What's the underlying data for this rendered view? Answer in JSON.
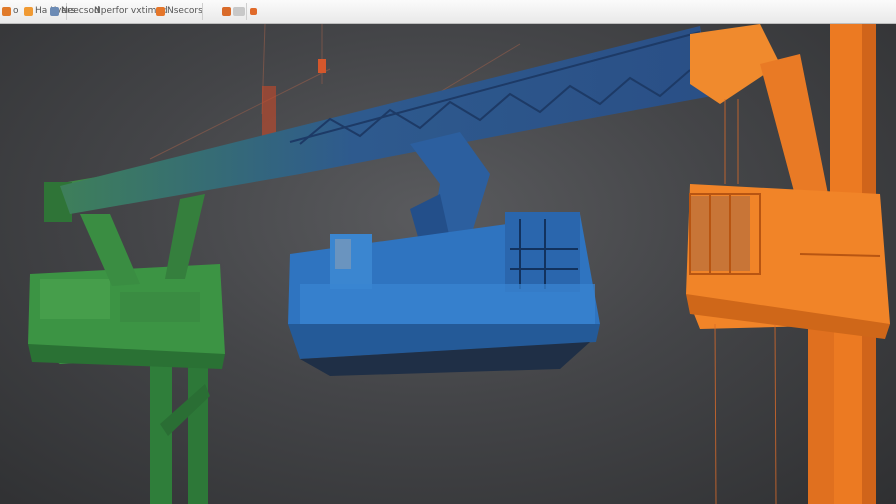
{
  "toolbar": {
    "items": [
      {
        "label": "o",
        "icon": "app-icon",
        "color": "#e07a2a"
      },
      {
        "label": "Ha Kvers",
        "icon": "file-icon",
        "color": "#f09a33"
      },
      {
        "label": "Neecsod",
        "icon": "edit-icon",
        "color": "#6c8bb5"
      },
      {
        "label": "Nperfor vxtimed",
        "icon": "view-icon",
        "color": "#a0a0a0"
      },
      {
        "label": "Nsecors",
        "icon": "image-icon",
        "color": "#e5762a"
      },
      {
        "label": "",
        "icon": "tool-icon",
        "color": "#d96b2a"
      }
    ]
  },
  "scene": {
    "description_colors": {
      "background": "#3a3b3d",
      "green_crane": "#3f8f3e",
      "blue_crane": "#2f6fb8",
      "orange_crane": "#ef7a1e"
    }
  }
}
